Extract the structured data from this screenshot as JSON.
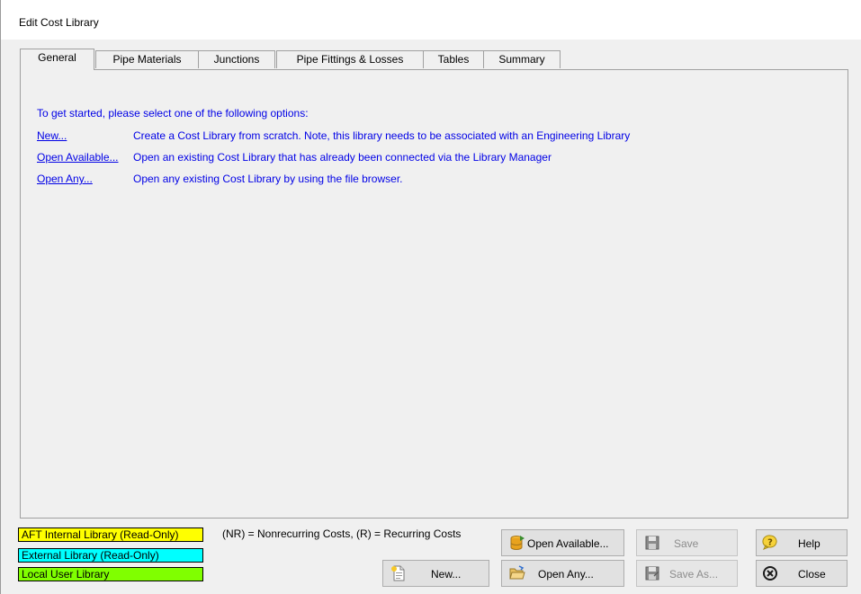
{
  "window": {
    "title": "Edit Cost Library"
  },
  "tabs": [
    {
      "label": "General"
    },
    {
      "label": "Pipe Materials"
    },
    {
      "label": "Junctions"
    },
    {
      "label": "Pipe Fittings & Losses"
    },
    {
      "label": "Tables"
    },
    {
      "label": "Summary"
    }
  ],
  "general": {
    "intro": "To get started, please select one of the following options:",
    "options": [
      {
        "link": "New...",
        "description": "Create a Cost Library from scratch. Note, this library needs to be associated with an Engineering Library"
      },
      {
        "link": "Open Available...",
        "description": "Open an existing Cost Library that has already been connected via the Library Manager"
      },
      {
        "link": "Open Any...",
        "description": "Open any existing Cost Library by using the file browser."
      }
    ]
  },
  "legend": [
    {
      "label": "AFT Internal Library (Read-Only)",
      "color": "#ffff00"
    },
    {
      "label": "External Library (Read-Only)",
      "color": "#00ffff"
    },
    {
      "label": "Local User Library",
      "color": "#80ff00"
    }
  ],
  "cost_note": "(NR) = Nonrecurring Costs, (R) = Recurring Costs",
  "buttons": {
    "new": "New...",
    "open_available": "Open Available...",
    "open_any": "Open Any...",
    "save": "Save",
    "save_as": "Save As...",
    "help": "Help",
    "close": "Close"
  },
  "icons": {
    "new": "new-document-icon",
    "open_available": "database-icon",
    "open_any": "open-folder-icon",
    "save": "floppy-disk-icon",
    "save_as": "floppy-disk-save-as-icon",
    "help": "help-question-icon",
    "close": "close-circle-icon"
  }
}
